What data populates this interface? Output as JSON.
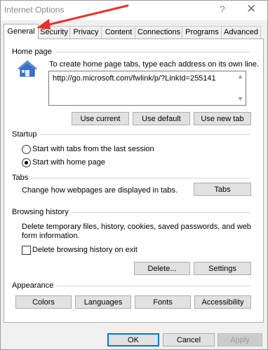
{
  "window": {
    "title": "Internet Options",
    "help": "?",
    "close": "✕"
  },
  "tabs": [
    {
      "label": "General",
      "active": true
    },
    {
      "label": "Security"
    },
    {
      "label": "Privacy"
    },
    {
      "label": "Content"
    },
    {
      "label": "Connections"
    },
    {
      "label": "Programs"
    },
    {
      "label": "Advanced"
    }
  ],
  "home_page": {
    "group": "Home page",
    "instructions": "To create home page tabs, type each address on its own line.",
    "url": "http://go.microsoft.com/fwlink/p/?LinkId=255141",
    "buttons": {
      "use_current": "Use current",
      "use_default": "Use default",
      "use_new_tab": "Use new tab"
    }
  },
  "startup": {
    "group": "Startup",
    "option_last_session": "Start with tabs from the last session",
    "option_home_page": "Start with home page",
    "selected": "home_page"
  },
  "tabs_section": {
    "group": "Tabs",
    "description": "Change how webpages are displayed in tabs.",
    "button": "Tabs"
  },
  "browsing_history": {
    "group": "Browsing history",
    "description_line1": "Delete temporary files, history, cookies, saved passwords, and web",
    "description_line2": "form information.",
    "checkbox_label": "Delete browsing history on exit",
    "checkbox_checked": false,
    "delete_button": "Delete...",
    "settings_button": "Settings"
  },
  "appearance": {
    "group": "Appearance",
    "colors": "Colors",
    "languages": "Languages",
    "fonts": "Fonts",
    "accessibility": "Accessibility"
  },
  "dialog": {
    "ok": "OK",
    "cancel": "Cancel",
    "apply": "Apply"
  },
  "colors": {
    "annotation_arrow": "#e8312a",
    "house_blue": "#3a70c8"
  }
}
